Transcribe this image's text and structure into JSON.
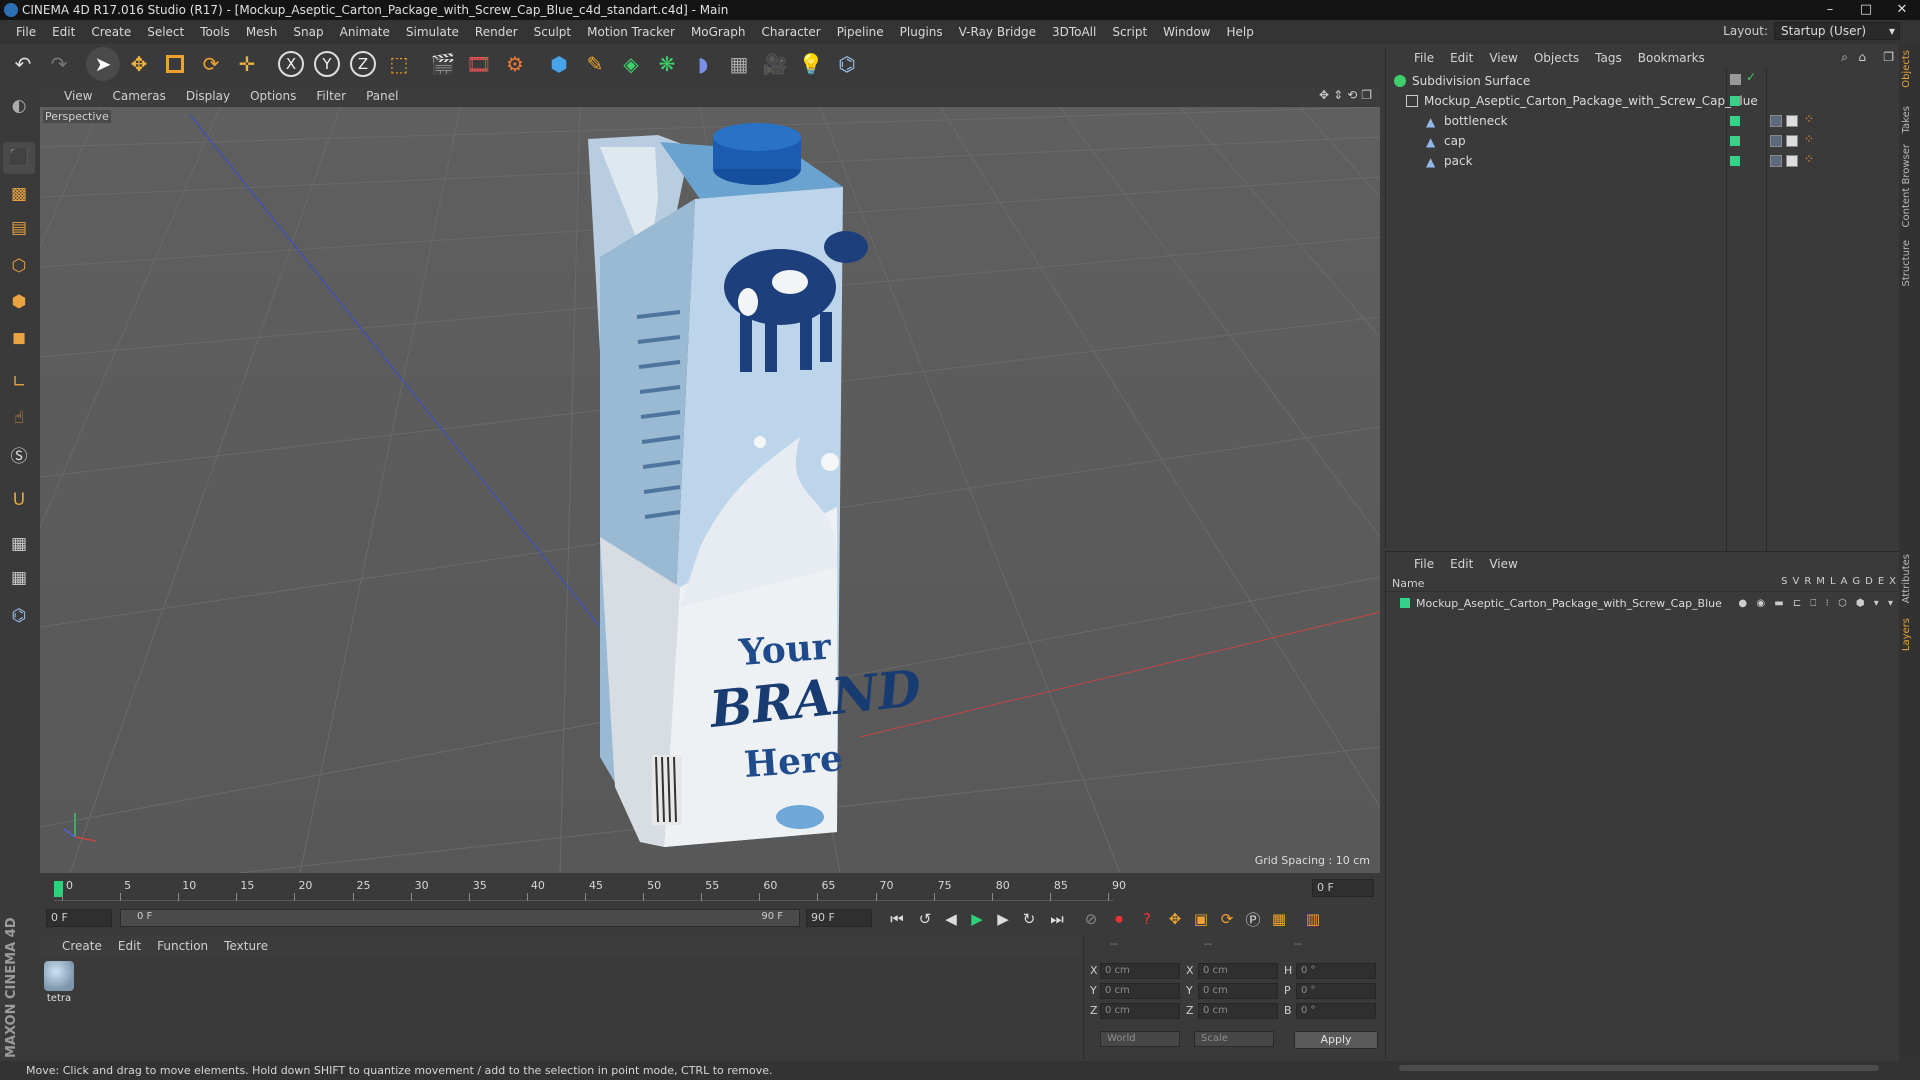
{
  "window": {
    "title": "CINEMA 4D R17.016 Studio (R17) - [Mockup_Aseptic_Carton_Package_with_Screw_Cap_Blue_c4d_standart.c4d] - Main",
    "controls": [
      "–",
      "□",
      "✕"
    ]
  },
  "menubar": {
    "items": [
      "File",
      "Edit",
      "Create",
      "Select",
      "Tools",
      "Mesh",
      "Snap",
      "Animate",
      "Simulate",
      "Render",
      "Sculpt",
      "Motion Tracker",
      "MoGraph",
      "Character",
      "Pipeline",
      "Plugins",
      "V-Ray Bridge",
      "3DToAll",
      "Script",
      "Window",
      "Help"
    ],
    "layout_label": "Layout:",
    "layout_value": "Startup (User)"
  },
  "toolbar": {
    "icons": [
      "undo-icon",
      "redo-icon",
      "select-arrow-icon",
      "move-icon",
      "scale-icon",
      "rotate-icon",
      "live-selection-icon",
      "x-axis-icon",
      "y-axis-icon",
      "z-axis-icon",
      "coordinate-system-icon",
      "render-view-icon",
      "render-picture-viewer-icon",
      "edit-render-settings-icon",
      "cube-icon",
      "pen-spline-icon",
      "subdivision-icon",
      "mograph-cloner-icon",
      "deformer-icon",
      "floor-icon",
      "camera-icon",
      "light-icon",
      "python-icon"
    ],
    "axis_labels": [
      "X",
      "Y",
      "Z"
    ]
  },
  "viewport": {
    "menu": [
      "View",
      "Cameras",
      "Display",
      "Options",
      "Filter",
      "Panel"
    ],
    "label": "Perspective",
    "grid_spacing": "Grid Spacing : 10 cm",
    "pack_text": [
      "Your",
      "BRAND",
      "Here"
    ]
  },
  "timeline": {
    "ticks": [
      "0",
      "5",
      "10",
      "15",
      "20",
      "25",
      "30",
      "35",
      "40",
      "45",
      "50",
      "55",
      "60",
      "65",
      "70",
      "75",
      "80",
      "85",
      "90"
    ],
    "current_frame": "0 F",
    "start_field": "0 F",
    "range_start": "0 F",
    "range_end": "90 F",
    "end_field": "90 F"
  },
  "materials": {
    "menu": [
      "Create",
      "Edit",
      "Function",
      "Texture"
    ],
    "items": [
      {
        "name": "tetra"
      }
    ]
  },
  "coordinates": {
    "headers": [
      "--",
      "--",
      "--"
    ],
    "rows": [
      {
        "a": "X",
        "v1": "0 cm",
        "b": "X",
        "v2": "0 cm",
        "c": "H",
        "v3": "0 °"
      },
      {
        "a": "Y",
        "v1": "0 cm",
        "b": "Y",
        "v2": "0 cm",
        "c": "P",
        "v3": "0 °"
      },
      {
        "a": "Z",
        "v1": "0 cm",
        "b": "Z",
        "v2": "0 cm",
        "c": "B",
        "v3": "0 °"
      }
    ],
    "mode": "World",
    "scale": "Scale",
    "apply": "Apply"
  },
  "objects": {
    "menu": [
      "File",
      "Edit",
      "View",
      "Objects",
      "Tags",
      "Bookmarks"
    ],
    "tree": [
      {
        "name": "Subdivision Surface"
      },
      {
        "name": "Mockup_Aseptic_Carton_Package_with_Screw_Cap_Blue"
      },
      {
        "name": "bottleneck"
      },
      {
        "name": "cap"
      },
      {
        "name": "pack"
      }
    ]
  },
  "layers": {
    "menu": [
      "File",
      "Edit",
      "View"
    ],
    "name_header": "Name",
    "col_headers": [
      "S",
      "V",
      "R",
      "M",
      "L",
      "A",
      "G",
      "D",
      "E",
      "X"
    ],
    "rows": [
      {
        "name": "Mockup_Aseptic_Carton_Package_with_Screw_Cap_Blue"
      }
    ]
  },
  "side_tabs": [
    "Objects",
    "Takes",
    "Content Browser",
    "Structure",
    "Attributes",
    "Layers"
  ],
  "brand": "MAXON CINEMA 4D",
  "status": "Move: Click and drag to move elements. Hold down SHIFT to quantize movement / add to the selection in point mode, CTRL to remove."
}
